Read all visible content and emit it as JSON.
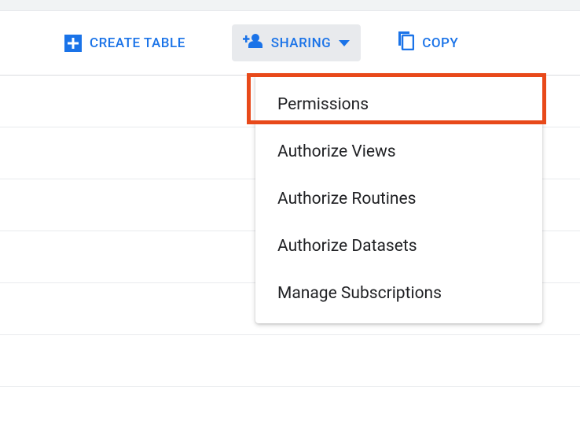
{
  "toolbar": {
    "create_table": "CREATE TABLE",
    "sharing": "SHARING",
    "copy": "COPY"
  },
  "sharing_menu": {
    "items": [
      "Permissions",
      "Authorize Views",
      "Authorize Routines",
      "Authorize Datasets",
      "Manage Subscriptions"
    ]
  },
  "colors": {
    "primary": "#1a73e8",
    "highlight": "#e8491a"
  }
}
